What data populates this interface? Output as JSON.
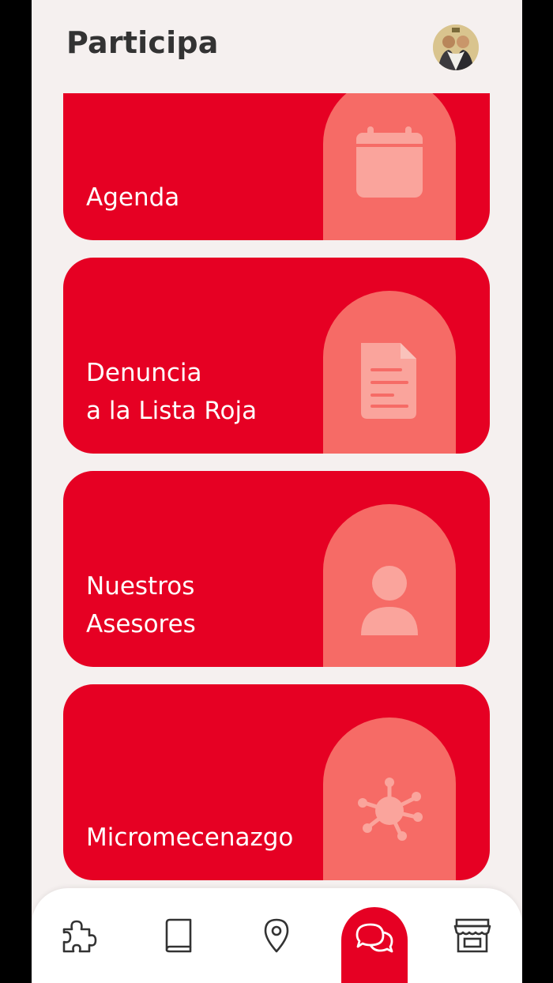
{
  "header": {
    "title": "Participa"
  },
  "cards": [
    {
      "label": "Agenda",
      "icon": "calendar-icon"
    },
    {
      "label": "Denuncia\na la Lista Roja",
      "icon": "document-icon"
    },
    {
      "label": "Nuestros\nAsesores",
      "icon": "person-icon"
    },
    {
      "label": "Micromecenazgo",
      "icon": "network-icon"
    }
  ],
  "bottom_nav": [
    {
      "icon": "puzzle-icon",
      "active": false
    },
    {
      "icon": "book-icon",
      "active": false
    },
    {
      "icon": "location-pin-icon",
      "active": false
    },
    {
      "icon": "chat-bubbles-icon",
      "active": true
    },
    {
      "icon": "store-icon",
      "active": false
    }
  ],
  "colors": {
    "accent_red": "#e60023",
    "arch_coral": "#f66b66",
    "icon_light": "#faa49c",
    "background": "#f5f0ef",
    "text_dark": "#333333"
  }
}
